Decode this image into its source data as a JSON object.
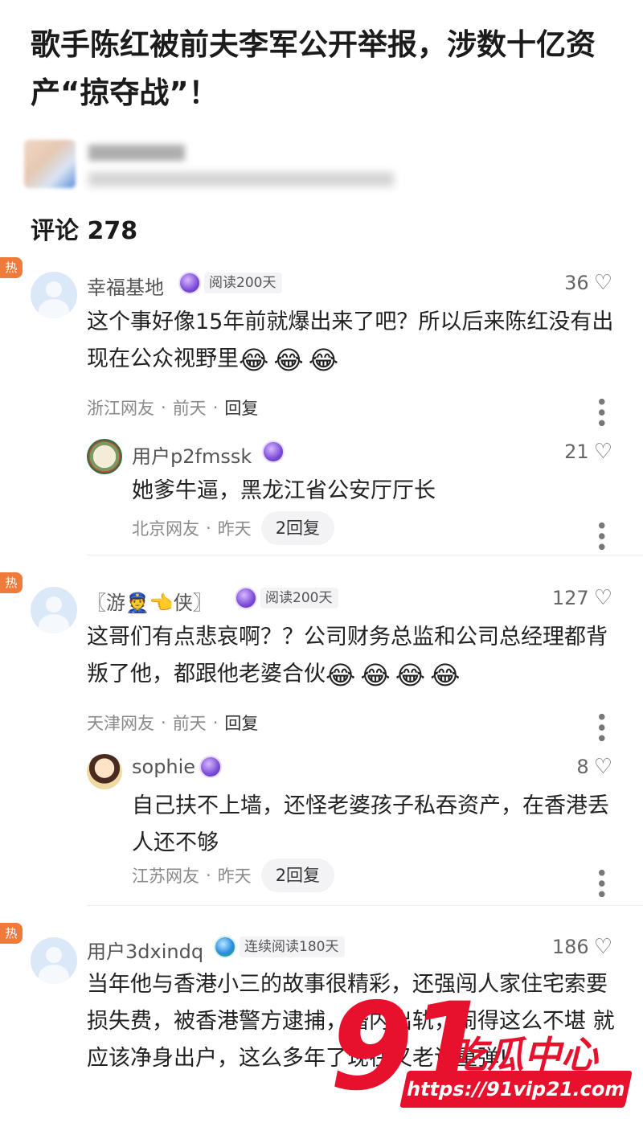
{
  "article": {
    "title": "歌手陈红被前夫李军公开举报，涉数十亿资产“掠夺战”！"
  },
  "comments_header": "评论 278",
  "hot_label": "热",
  "comments": [
    {
      "name": "幸福基地",
      "badge": "阅读200天",
      "likes": "36",
      "text": "这个事好像15年前就爆出来了吧？所以后来陈红没有出现在公众视野里",
      "emoji": "😂😂😂",
      "location": "浙江网友",
      "time": "前天",
      "reply": "回复",
      "sub": {
        "name": "用户p2fmssk",
        "likes": "21",
        "text": "她爹牛逼，黑龙江省公安厅厅长",
        "location": "北京网友",
        "time": "昨天",
        "reply_count": "2回复"
      }
    },
    {
      "name": "〖游👮👈侠〗",
      "badge": "阅读200天",
      "likes": "127",
      "text": "这哥们有点悲哀啊？？公司财务总监和公司总经理都背叛了他，都跟他老婆合伙",
      "emoji": "😂😂😂😂",
      "location": "天津网友",
      "time": "前天",
      "reply": "回复",
      "sub": {
        "name": "sophie",
        "likes": "8",
        "text": "自己扶不上墙，还怪老婆孩子私吞资产，在香港丢人还不够",
        "location": "江苏网友",
        "time": "昨天",
        "reply_count": "2回复"
      }
    },
    {
      "name": "用户3dxindq",
      "badge": "连续阅读180天",
      "likes": "186",
      "text": "当年他与香港小三的故事很精彩，还强闯人家住宅索要损失费，被香港警方逮捕，婚内出轨，闹得这么不堪 就应该净身出户，这么多年了现在又老调重弹!"
    }
  ],
  "watermark": {
    "number": "91",
    "brand": "吃瓜中心",
    "url": "https://91vip21.com"
  },
  "colors": {
    "hot": "#f07a3a",
    "watermark": "#e8112d"
  }
}
